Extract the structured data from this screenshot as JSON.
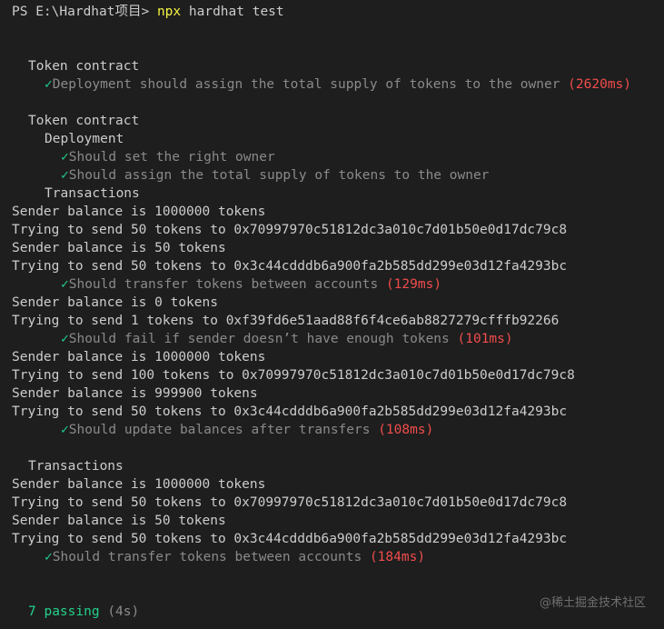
{
  "prompt": {
    "path": "PS E:\\Hardhat项目> ",
    "command": "npx",
    "args": " hardhat test"
  },
  "icons": {
    "check": "check-icon"
  },
  "suite1": {
    "title": "Token contract",
    "test": "Deployment should assign the total supply of tokens to the owner",
    "duration": "(2620ms)"
  },
  "suite2": {
    "title": "Token contract",
    "deployment": {
      "title": "Deployment",
      "test1": "Should set the right owner",
      "test2": "Should assign the total supply of tokens to the owner"
    },
    "transactions": {
      "title": "Transactions",
      "block1": {
        "log1": "Sender balance is 1000000 tokens",
        "log2": "Trying to send 50 tokens to 0x70997970c51812dc3a010c7d01b50e0d17dc79c8",
        "log3": "Sender balance is 50 tokens",
        "log4": "Trying to send 50 tokens to 0x3c44cdddb6a900fa2b585dd299e03d12fa4293bc",
        "test": "Should transfer tokens between accounts",
        "duration": "(129ms)"
      },
      "block2": {
        "log1": "Sender balance is 0 tokens",
        "log2": "Trying to send 1 tokens to 0xf39fd6e51aad88f6f4ce6ab8827279cfffb92266",
        "test": "Should fail if sender doesn’t have enough tokens",
        "duration": "(101ms)"
      },
      "block3": {
        "log1": "Sender balance is 1000000 tokens",
        "log2": "Trying to send 100 tokens to 0x70997970c51812dc3a010c7d01b50e0d17dc79c8",
        "log3": "Sender balance is 999900 tokens",
        "log4": "Trying to send 50 tokens to 0x3c44cdddb6a900fa2b585dd299e03d12fa4293bc",
        "test": "Should update balances after transfers",
        "duration": "(108ms)"
      }
    }
  },
  "suite3": {
    "title": "Transactions",
    "log1": "Sender balance is 1000000 tokens",
    "log2": "Trying to send 50 tokens to 0x70997970c51812dc3a010c7d01b50e0d17dc79c8",
    "log3": "Sender balance is 50 tokens",
    "log4": "Trying to send 50 tokens to 0x3c44cdddb6a900fa2b585dd299e03d12fa4293bc",
    "test": "Should transfer tokens between accounts",
    "duration": "(184ms)"
  },
  "summary": {
    "passing": "7 passing",
    "time": "(4s)"
  },
  "watermark": "@稀土掘金技术社区",
  "colors": {
    "background": "#1e1e1e",
    "text": "#cccccc",
    "check": "#23d18b",
    "duration": "#f14c4c",
    "command": "#f5f543",
    "muted": "#8a8a8a"
  }
}
